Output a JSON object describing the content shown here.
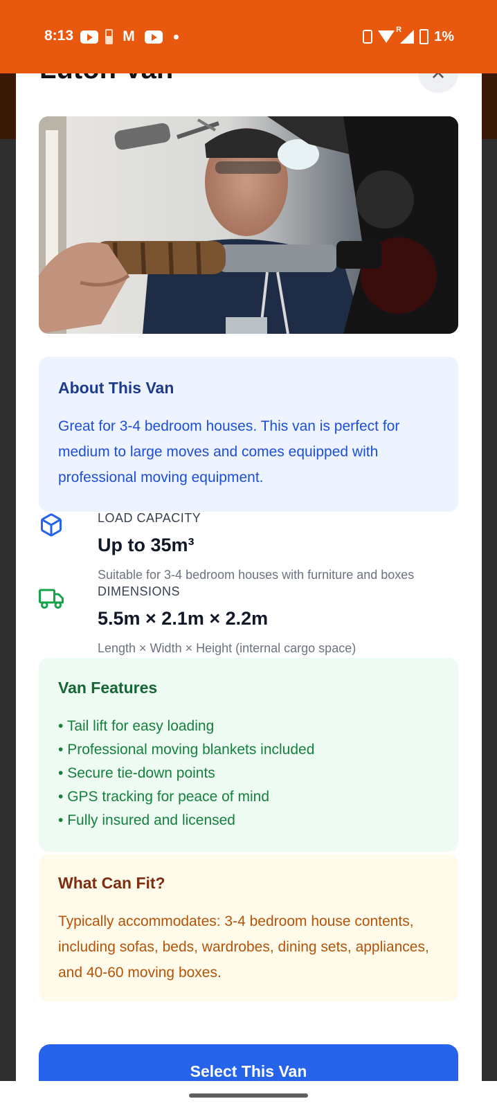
{
  "status_bar": {
    "time": "8:13",
    "battery_percent": "1%",
    "signal_badge": "R",
    "mail_glyph": "M",
    "background": "#e8580f"
  },
  "modal": {
    "title": "Luton Van",
    "close_glyph": "×"
  },
  "about": {
    "title": "About This Van",
    "text": "Great for 3-4 bedroom houses. This van is perfect for medium to large moves and comes equipped with professional moving equipment."
  },
  "specs": {
    "capacity": {
      "label": "LOAD CAPACITY",
      "value": "Up to 35m³",
      "note": "Suitable for 3-4 bedroom houses with furniture and boxes",
      "icon": "box-icon"
    },
    "dimensions": {
      "label": "DIMENSIONS",
      "value": "5.5m × 2.1m × 2.2m",
      "note": "Length × Width × Height (internal cargo space)",
      "icon": "truck-icon"
    }
  },
  "features": {
    "title": "Van Features",
    "items": [
      "Tail lift for easy loading",
      "Professional moving blankets included",
      "Secure tie-down points",
      "GPS tracking for peace of mind",
      "Fully insured and licensed"
    ]
  },
  "fit": {
    "title": "What Can Fit?",
    "text": "Typically accommodates: 3-4 bedroom house contents, including sofas, beds, wardrobes, dining sets, appliances, and 40-60 moving boxes."
  },
  "actions": {
    "select_label": "Select This Van",
    "accent": "#2563eb"
  }
}
